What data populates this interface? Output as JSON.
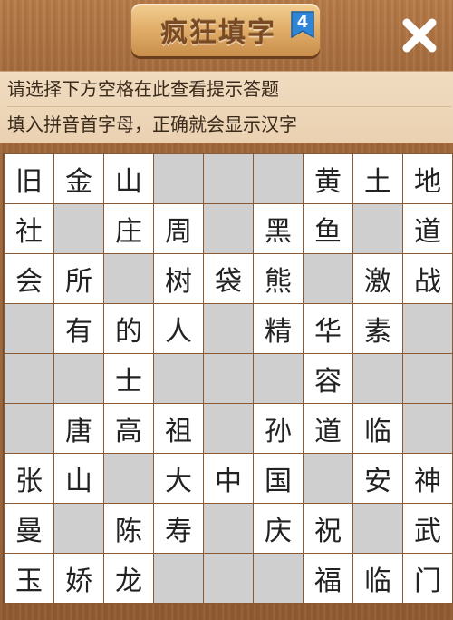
{
  "header": {
    "title": "疯狂填字",
    "level_badge": "4",
    "close_icon": "close-icon"
  },
  "hints": {
    "line1": "请选择下方空格在此查看提示答题",
    "line2": "填入拼音首字母，正确就会显示汉字"
  },
  "grid": {
    "rows": 9,
    "cols": 9,
    "cells": [
      [
        "旧",
        "金",
        "山",
        "",
        "",
        "",
        "黄",
        "土",
        "地"
      ],
      [
        "社",
        "",
        "庄",
        "周",
        "",
        "黑",
        "鱼",
        "",
        "道"
      ],
      [
        "会",
        "所",
        "",
        "树",
        "袋",
        "熊",
        "",
        "激",
        "战"
      ],
      [
        "",
        "有",
        "的",
        "人",
        "",
        "精",
        "华",
        "素",
        ""
      ],
      [
        "",
        "",
        "士",
        "",
        "",
        "",
        "容",
        "",
        ""
      ],
      [
        "",
        "唐",
        "高",
        "祖",
        "",
        "孙",
        "道",
        "临",
        ""
      ],
      [
        "张",
        "山",
        "",
        "大",
        "中",
        "国",
        "",
        "安",
        "神"
      ],
      [
        "曼",
        "",
        "陈",
        "寿",
        "",
        "庆",
        "祝",
        "",
        "武"
      ],
      [
        "玉",
        "娇",
        "龙",
        "",
        "",
        "",
        "福",
        "临",
        "门"
      ]
    ]
  },
  "colors": {
    "wood": "#9a6235",
    "hint_bg": "#ead1b2",
    "blank_cell": "#cfcfcf",
    "filled_cell": "#ffffff",
    "badge_blue": "#2f86d6"
  }
}
